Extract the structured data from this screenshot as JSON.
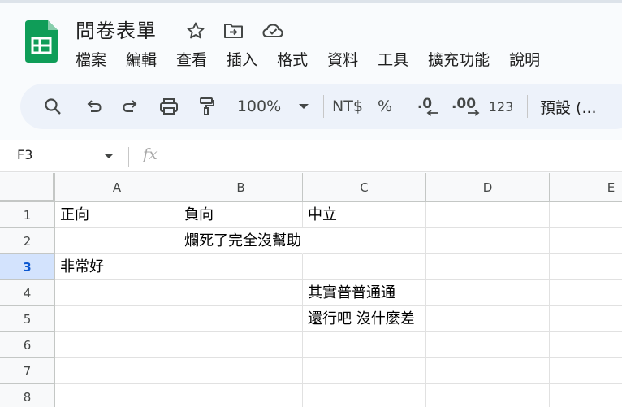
{
  "document": {
    "title": "問卷表單"
  },
  "menu": [
    "檔案",
    "編輯",
    "查看",
    "插入",
    "格式",
    "資料",
    "工具",
    "擴充功能",
    "說明"
  ],
  "toolbar": {
    "zoom": "100%",
    "currency": "NT$",
    "percent": "%",
    "decrease_decimal": ".0",
    "increase_decimal": ".00",
    "number_format": "123",
    "font": "預設 (..."
  },
  "formula_bar": {
    "cell_ref": "F3",
    "fx": "fx",
    "value": ""
  },
  "grid": {
    "columns": [
      "A",
      "B",
      "C",
      "D",
      "E"
    ],
    "rows": [
      "1",
      "2",
      "3",
      "4",
      "5",
      "6",
      "7",
      "8"
    ],
    "active_row": "3",
    "cells": {
      "A1": "正向",
      "B1": "負向",
      "C1": "中立",
      "B2": "爛死了完全沒幫助",
      "A3": "非常好",
      "C4": "其實普普通通",
      "C5": "還行吧 沒什麼差"
    }
  },
  "colors": {
    "sheets_green": "#0f9d58",
    "active_row_bg": "#d3e3fd",
    "active_row_text": "#0b57d0",
    "toolbar_bg": "#edf2fa"
  }
}
